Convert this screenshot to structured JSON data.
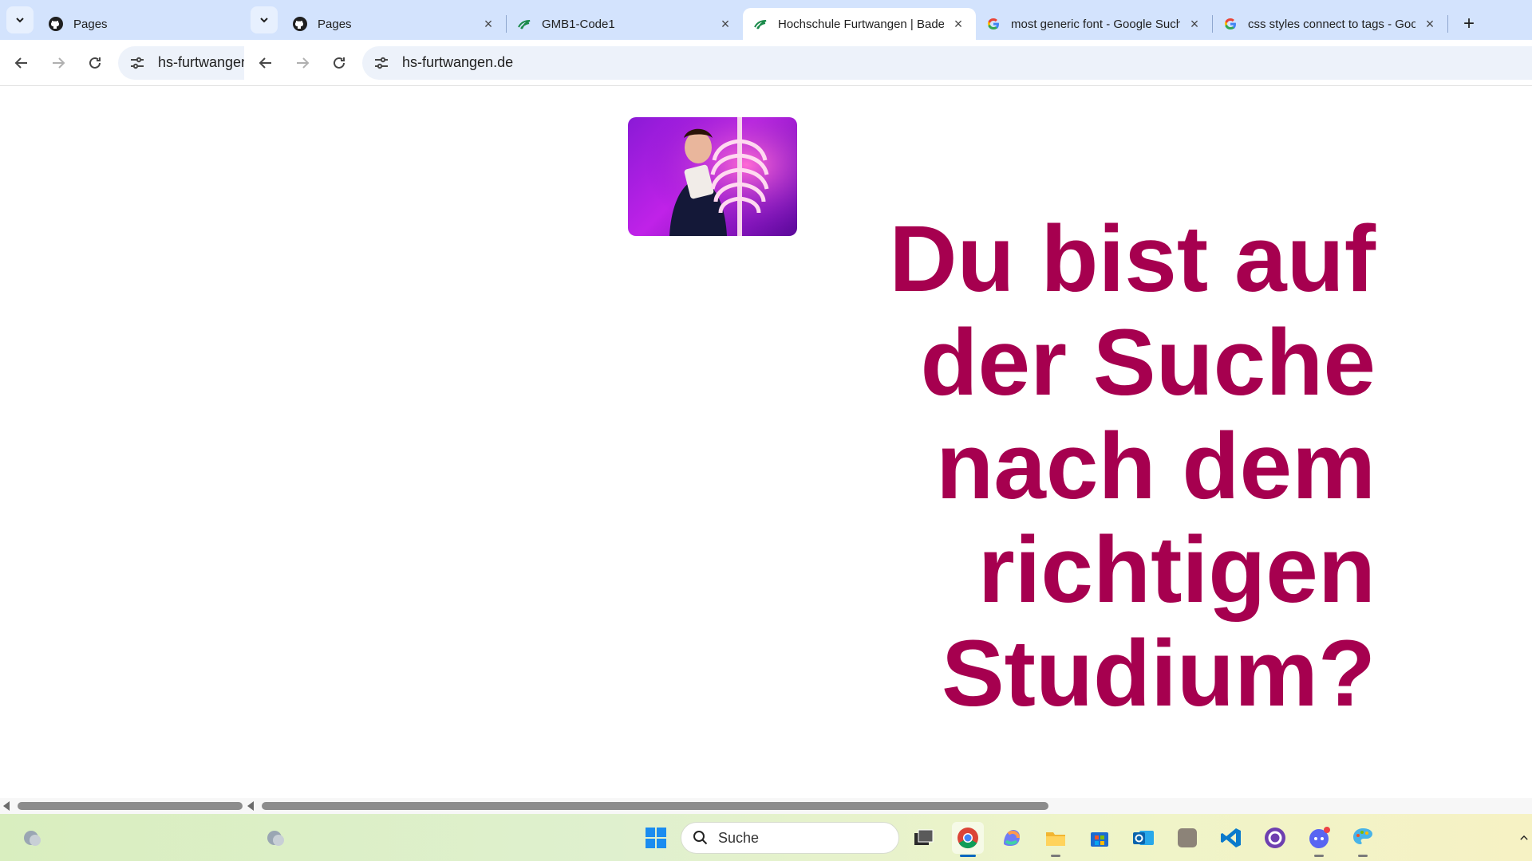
{
  "browser_left": {
    "tabs": [
      {
        "title": "Pages",
        "favicon": "github-icon"
      }
    ],
    "url": "hs-furtwangen"
  },
  "browser_right": {
    "tabs": [
      {
        "title": "Pages",
        "favicon": "github-icon",
        "closable": true
      },
      {
        "title": "GMB1-Code1",
        "favicon": "hfu-logo-icon",
        "closable": true
      },
      {
        "title": "Hochschule Furtwangen | Baden-",
        "favicon": "hfu-logo-icon",
        "closable": true,
        "active": true
      },
      {
        "title": "most generic font - Google Suche",
        "favicon": "google-icon",
        "closable": true
      },
      {
        "title": "css styles connect to tags - Goo",
        "favicon": "google-icon",
        "closable": true
      }
    ],
    "url": "hs-furtwangen.de"
  },
  "page": {
    "headline_lines": [
      "Du bist auf",
      "der Suche",
      "nach dem",
      "richtigen",
      "Studium?"
    ],
    "headline_color": "#a6004f"
  },
  "taskbar": {
    "search_placeholder": "Suche",
    "icons": [
      "weather-icon",
      "weather-icon",
      "windows-start-icon",
      "task-view-icon",
      "chrome-icon",
      "copilot-icon",
      "file-explorer-icon",
      "store-icon",
      "outlook-icon",
      "generic-app-icon",
      "vscode-icon",
      "github-desktop-icon",
      "discord-icon",
      "paint-icon",
      "chevron-up-icon"
    ]
  },
  "colors": {
    "tabstrip": "#d3e3fd",
    "omnibox": "#edf2fa",
    "accent": "#a6004f"
  }
}
